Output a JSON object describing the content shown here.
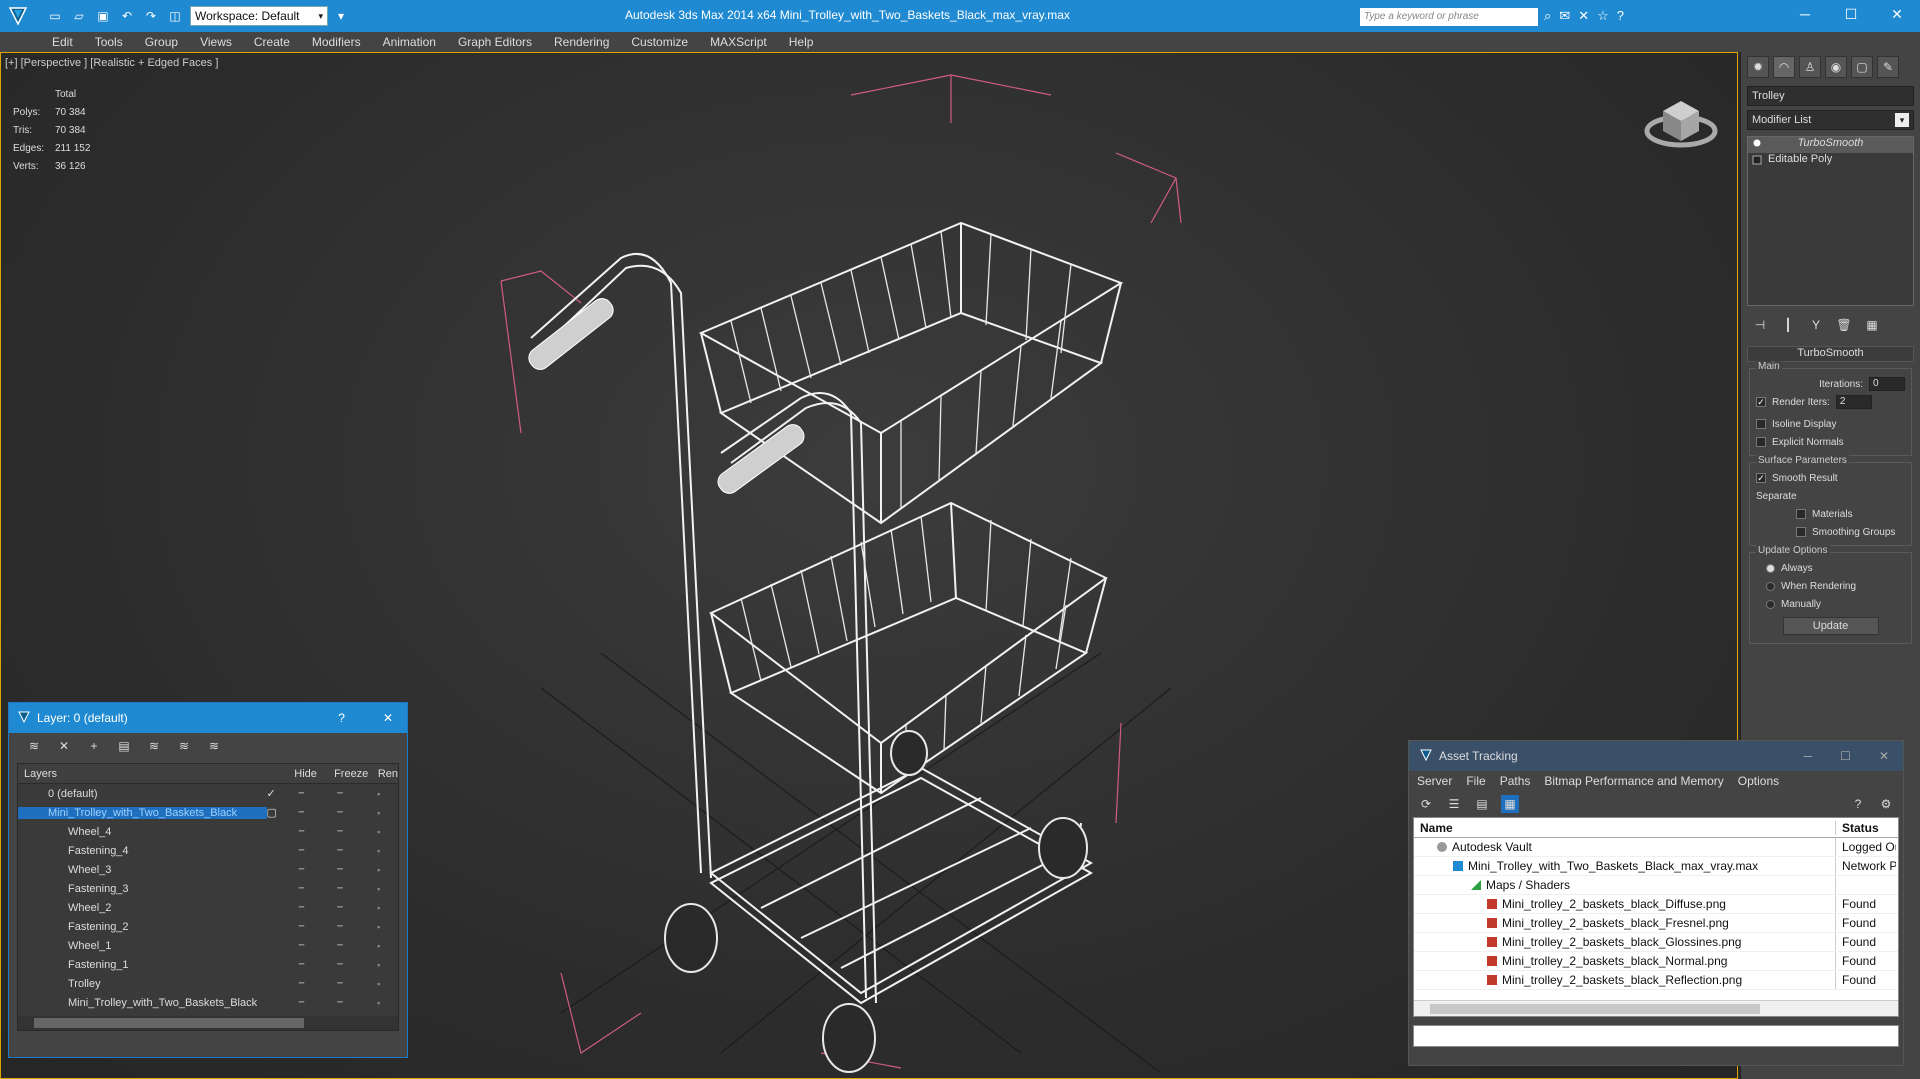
{
  "titlebar": {
    "workspace": "Workspace: Default",
    "title": "Autodesk 3ds Max  2014 x64      Mini_Trolley_with_Two_Baskets_Black_max_vray.max",
    "search_placeholder": "Type a keyword or phrase"
  },
  "menu": [
    "Edit",
    "Tools",
    "Group",
    "Views",
    "Create",
    "Modifiers",
    "Animation",
    "Graph Editors",
    "Rendering",
    "Customize",
    "MAXScript",
    "Help"
  ],
  "viewport": {
    "label": "[+] [Perspective ] [Realistic + Edged Faces ]",
    "stats": {
      "header": "Total",
      "polys_label": "Polys:",
      "polys": "70 384",
      "tris_label": "Tris:",
      "tris": "70 384",
      "edges_label": "Edges:",
      "edges": "211 152",
      "verts_label": "Verts:",
      "verts": "36 126"
    }
  },
  "command_panel": {
    "object_name": "Trolley",
    "modifier_list": "Modifier List",
    "stack": [
      "TurboSmooth",
      "Editable Poly"
    ],
    "rollout": "TurboSmooth",
    "main_label": "Main",
    "iterations_label": "Iterations:",
    "iterations": "0",
    "render_iters_label": "Render Iters:",
    "render_iters": "2",
    "isoline": "Isoline Display",
    "explicit_normals": "Explicit Normals",
    "surface_params": "Surface Parameters",
    "smooth_result": "Smooth Result",
    "separate": "Separate",
    "materials": "Materials",
    "smoothing_groups": "Smoothing Groups",
    "update_options": "Update Options",
    "always": "Always",
    "when_rendering": "When Rendering",
    "manually": "Manually",
    "update_btn": "Update"
  },
  "layer_dialog": {
    "title": "Layer: 0 (default)",
    "help": "?",
    "columns": [
      "Layers",
      "Hide",
      "Freeze",
      "Ren"
    ],
    "rows": [
      {
        "name": "0 (default)",
        "level": 0
      },
      {
        "name": "Mini_Trolley_with_Two_Baskets_Black",
        "level": 0,
        "selected": true
      },
      {
        "name": "Wheel_4",
        "level": 1
      },
      {
        "name": "Fastening_4",
        "level": 1
      },
      {
        "name": "Wheel_3",
        "level": 1
      },
      {
        "name": "Fastening_3",
        "level": 1
      },
      {
        "name": "Wheel_2",
        "level": 1
      },
      {
        "name": "Fastening_2",
        "level": 1
      },
      {
        "name": "Wheel_1",
        "level": 1
      },
      {
        "name": "Fastening_1",
        "level": 1
      },
      {
        "name": "Trolley",
        "level": 1
      },
      {
        "name": "Mini_Trolley_with_Two_Baskets_Black",
        "level": 1
      }
    ]
  },
  "asset_tracking": {
    "title": "Asset Tracking",
    "menu": [
      "Server",
      "File",
      "Paths",
      "Bitmap Performance and Memory",
      "Options"
    ],
    "columns": [
      "Name",
      "Status"
    ],
    "rows": [
      {
        "name": "Autodesk Vault",
        "status": "Logged Ou",
        "indent": 1
      },
      {
        "name": "Mini_Trolley_with_Two_Baskets_Black_max_vray.max",
        "status": "Network P",
        "indent": 2
      },
      {
        "name": "Maps / Shaders",
        "status": "",
        "indent": 3
      },
      {
        "name": "Mini_trolley_2_baskets_black_Diffuse.png",
        "status": "Found",
        "indent": 4
      },
      {
        "name": "Mini_trolley_2_baskets_black_Fresnel.png",
        "status": "Found",
        "indent": 4
      },
      {
        "name": "Mini_trolley_2_baskets_black_Glossines.png",
        "status": "Found",
        "indent": 4
      },
      {
        "name": "Mini_trolley_2_baskets_black_Normal.png",
        "status": "Found",
        "indent": 4
      },
      {
        "name": "Mini_trolley_2_baskets_black_Reflection.png",
        "status": "Found",
        "indent": 4
      }
    ]
  }
}
